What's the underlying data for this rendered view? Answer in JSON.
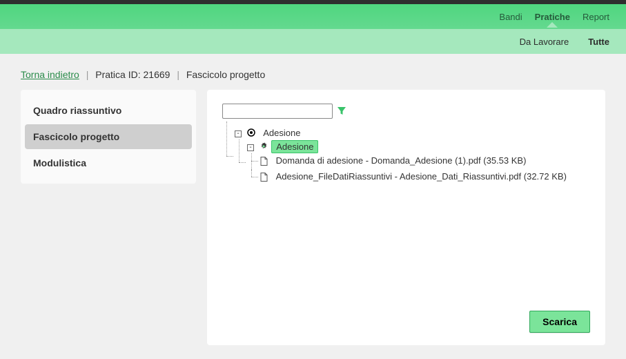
{
  "nav": {
    "items": [
      {
        "label": "Bandi",
        "active": false
      },
      {
        "label": "Pratiche",
        "active": true
      },
      {
        "label": "Report",
        "active": false
      }
    ]
  },
  "subnav": {
    "items": [
      {
        "label": "Da Lavorare",
        "active": false
      },
      {
        "label": "Tutte",
        "active": true
      }
    ]
  },
  "breadcrumb": {
    "back": "Torna indietro",
    "id_label": "Pratica ID: 21669",
    "section": "Fascicolo progetto"
  },
  "sidebar": {
    "items": [
      {
        "label": "Quadro riassuntivo",
        "active": false
      },
      {
        "label": "Fascicolo progetto",
        "active": true
      },
      {
        "label": "Modulistica",
        "active": false
      }
    ]
  },
  "search": {
    "value": ""
  },
  "tree": {
    "root": {
      "label": "Adesione",
      "icon": "radio"
    },
    "folder": {
      "label": "Adesione",
      "icon": "gear",
      "selected": true
    },
    "files": [
      {
        "label": "Domanda di adesione - Domanda_Adesione (1).pdf (35.53 KB)"
      },
      {
        "label": "Adesione_FileDatiRiassuntivi - Adesione_Dati_Riassuntivi.pdf (32.72 KB)"
      }
    ]
  },
  "actions": {
    "download": "Scarica"
  }
}
